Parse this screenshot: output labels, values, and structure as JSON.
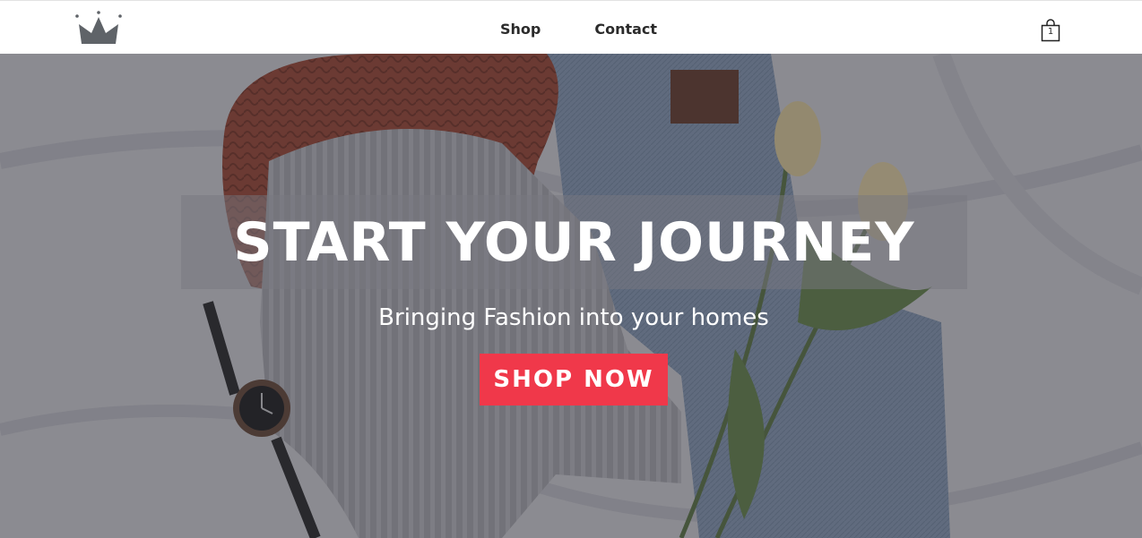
{
  "nav": {
    "logo_icon": "crown-icon",
    "links": [
      "Shop",
      "Contact"
    ],
    "cart_icon": "shopping-bag-icon",
    "cart_count": "1"
  },
  "hero": {
    "title": "START YOUR JOURNEY",
    "subtitle": "Bringing Fashion into your homes",
    "cta_label": "SHOP NOW"
  },
  "colors": {
    "cta_background": "#f0384a",
    "nav_text": "#2b2b2b",
    "hero_text": "#ffffff"
  }
}
